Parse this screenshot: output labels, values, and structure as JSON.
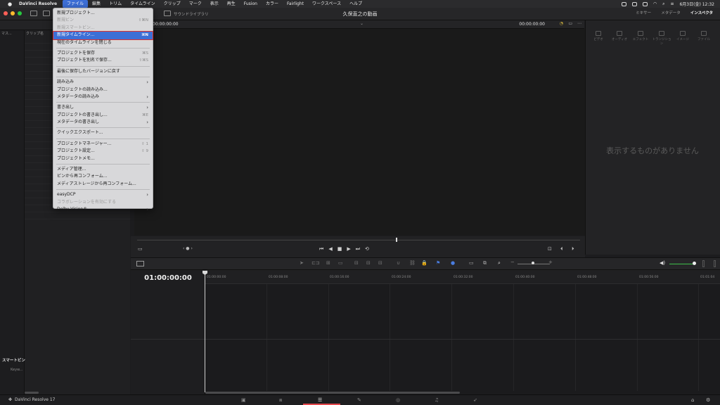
{
  "menubar": {
    "app_name": "DaVinci Resolve",
    "menus": [
      "ファイル",
      "編集",
      "トリム",
      "タイムライン",
      "クリップ",
      "マーク",
      "表示",
      "再生",
      "Fusion",
      "カラー",
      "Fairlight",
      "ワークスペース",
      "ヘルプ"
    ],
    "active_menu": "ファイル",
    "date_time": "6月3日(金)  12:32"
  },
  "toolbar": {
    "project_title": "久保直之の動画",
    "sound_library": "サウンドライブラリ",
    "mixer": "ミキサー",
    "metadata": "メタデータ",
    "inspector": "インスペクタ"
  },
  "left_panel": {
    "side_label": "マス...",
    "col_header": "クリップ名",
    "smart_bins": "スマートビン",
    "keywords": "Keyw..."
  },
  "viewer": {
    "timecode_left": "00:00:00:00",
    "timecode_right": "00:00:00:00"
  },
  "inspector": {
    "tabs": [
      "ビデオ",
      "オーディオ",
      "エフェクト",
      "トランジション",
      "イメージ",
      "ファイル"
    ],
    "empty_message": "表示するものがありません"
  },
  "timeline": {
    "timecode": "01:00:00:00",
    "ruler": [
      "01:00:00:00",
      "01:00:08:00",
      "01:00:16:00",
      "01:00:24:00",
      "01:00:32:00",
      "01:00:40:00",
      "01:00:48:00",
      "01:00:56:00",
      "01:01:04"
    ]
  },
  "pagebar": {
    "brand": "DaVinci Resolve 17"
  },
  "file_menu": {
    "items": [
      {
        "label": "新規プロジェクト...",
        "shortcut": "",
        "disabled": false
      },
      {
        "label": "新規ビン",
        "shortcut": "⇧⌘N",
        "disabled": true
      },
      {
        "label": "新規スマートビン...",
        "shortcut": "",
        "disabled": true
      },
      {
        "label": "新規タイムライン...",
        "shortcut": "⌘N",
        "disabled": false,
        "highlight": true
      },
      {
        "label": "現在のタイムラインを閉じる",
        "shortcut": "",
        "disabled": false,
        "sep_after": true
      },
      {
        "label": "プロジェクトを保存",
        "shortcut": "⌘S",
        "disabled": false
      },
      {
        "label": "プロジェクトを別名で保存...",
        "shortcut": "⇧⌘S",
        "disabled": false,
        "sep_after": true
      },
      {
        "label": "最後に保存したバージョンに戻す",
        "shortcut": "",
        "disabled": false,
        "sep_after": true
      },
      {
        "label": "読み込み",
        "submenu": true,
        "disabled": false
      },
      {
        "label": "プロジェクトの読み込み...",
        "shortcut": "",
        "disabled": false
      },
      {
        "label": "メタデータの読み込み",
        "submenu": true,
        "disabled": false,
        "sep_after": true
      },
      {
        "label": "書き出し",
        "submenu": true,
        "disabled": false
      },
      {
        "label": "プロジェクトの書き出し...",
        "shortcut": "⌘E",
        "disabled": false
      },
      {
        "label": "メタデータの書き出し",
        "submenu": true,
        "disabled": false,
        "sep_after": true
      },
      {
        "label": "クイックエクスポート...",
        "shortcut": "",
        "disabled": false,
        "sep_after": true
      },
      {
        "label": "プロジェクトマネージャー...",
        "shortcut": "⇧ 1",
        "disabled": false
      },
      {
        "label": "プロジェクト設定...",
        "shortcut": "⇧ 9",
        "disabled": false
      },
      {
        "label": "プロジェクトメモ...",
        "shortcut": "",
        "disabled": false,
        "sep_after": true
      },
      {
        "label": "メディア管理...",
        "shortcut": "",
        "disabled": false
      },
      {
        "label": "ビンから再コンフォーム...",
        "shortcut": "",
        "disabled": false
      },
      {
        "label": "メディアストレージから再コンフォーム...",
        "shortcut": "",
        "disabled": false,
        "sep_after": true
      },
      {
        "label": "easyDCP",
        "submenu": true,
        "disabled": false
      },
      {
        "label": "コラボレーションを有効にする",
        "shortcut": "",
        "disabled": true
      },
      {
        "label": "Dolby Vision®",
        "submenu": true,
        "disabled": false
      }
    ]
  }
}
